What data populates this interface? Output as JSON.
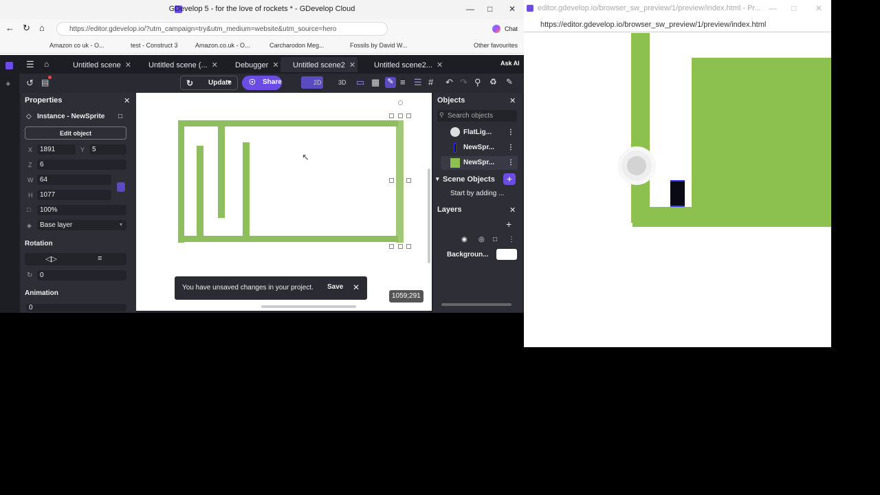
{
  "window1": {
    "title": "GDevelop 5 - for the love of rockets * - GDevelop Cloud",
    "url": "https://editor.gdevelop.io/?utm_campaign=try&utm_medium=website&utm_source=hero",
    "chat_label": "Chat",
    "bookmarks": [
      "Amazon co uk - O...",
      "test - Construct 3",
      "Amazon.co.uk - O...",
      "Carcharodon Meg...",
      "Fossils by David W...",
      "Other favourites"
    ]
  },
  "tabs": [
    {
      "label": "Untitled scene"
    },
    {
      "label": "Untitled scene (..."
    },
    {
      "label": "Debugger"
    },
    {
      "label": "Untitled scene2"
    },
    {
      "label": "Untitled scene2..."
    }
  ],
  "ask_ai": "Ask AI",
  "toolbar": {
    "update": "Update",
    "share": "Share",
    "mode2d": "2D",
    "mode3d": "3D"
  },
  "properties": {
    "header": "Properties",
    "instance": "Instance - NewSprite",
    "edit_object": "Edit object",
    "x_label": "X",
    "x": "1891",
    "y_label": "Y",
    "y": "5",
    "z_label": "Z",
    "z": "6",
    "w_label": "W",
    "w": "64",
    "h_label": "H",
    "h": "1077",
    "opacity": "100%",
    "layer": "Base layer",
    "rotation_header": "Rotation",
    "rotation": "0",
    "animation_header": "Animation",
    "animation": "0"
  },
  "canvas": {
    "toast": "You have unsaved changes in your project.",
    "save": "Save",
    "coords": "1059;291"
  },
  "objects": {
    "header": "Objects",
    "search_placeholder": "Search objects",
    "items": [
      "FlatLig...",
      "NewSpr...",
      "NewSpr..."
    ],
    "scene_objects": "Scene Objects",
    "scene_hint": "Start by adding ...",
    "layers": "Layers",
    "background": "Backgroun..."
  },
  "window2": {
    "title": "editor.gdevelop.io/browser_sw_preview/1/preview/index.html - Pr...",
    "url": "https://editor.gdevelop.io/browser_sw_preview/1/preview/index.html"
  },
  "colors": {
    "accent": "#6b4de6",
    "sprite_green": "#8cc04f"
  }
}
